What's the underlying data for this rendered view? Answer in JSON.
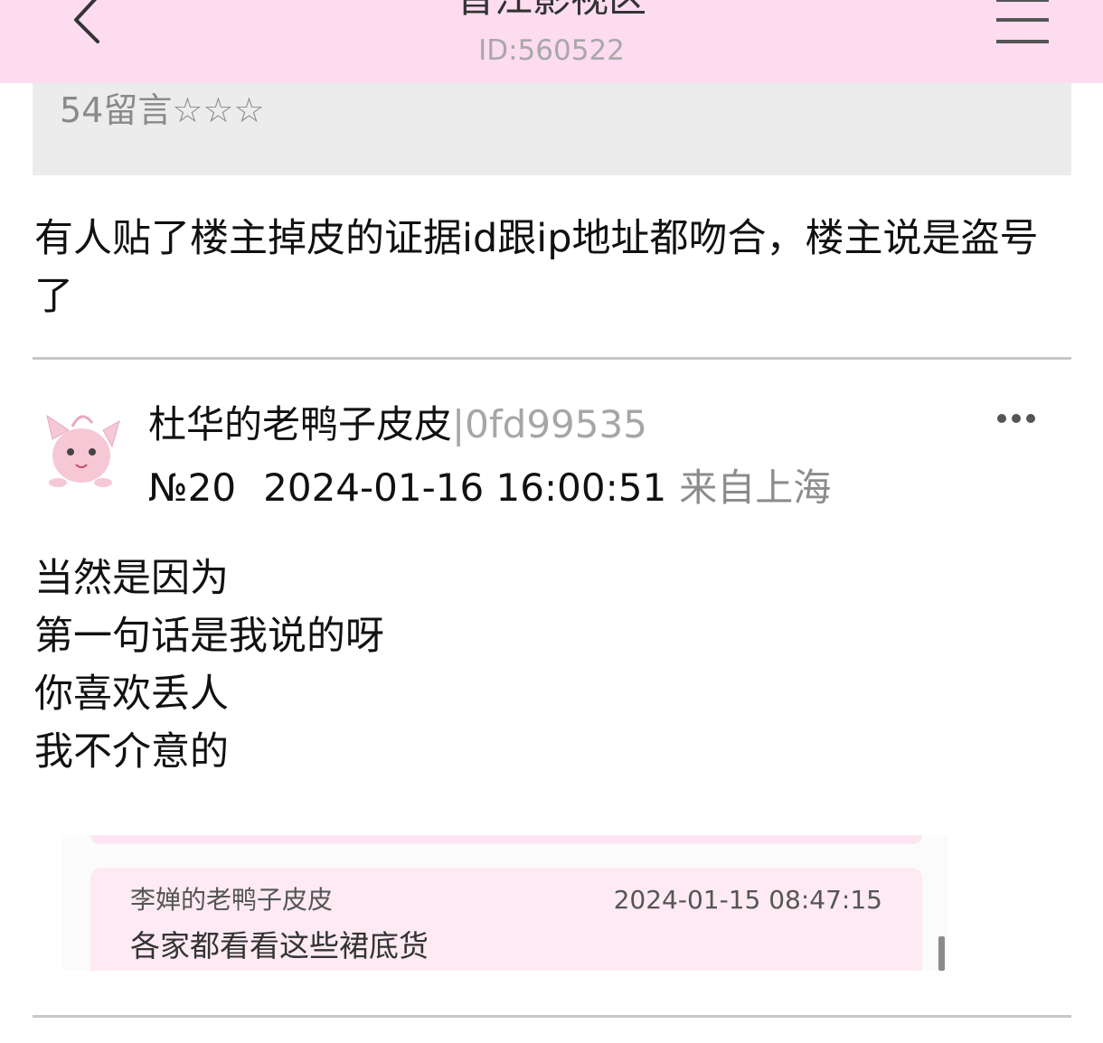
{
  "header": {
    "title": "晋江影视区",
    "subtitle": "ID:560522",
    "back_icon": "chevron-left-icon",
    "menu_icon": "hamburger-menu-icon",
    "background": "#fddcef"
  },
  "quoted_post": {
    "text": "54留言☆☆☆"
  },
  "post": {
    "body": "有人贴了楼主掉皮的证据id跟ip地址都吻合，楼主说是盗号了"
  },
  "reply": {
    "username": "杜华的老鸭子皮皮",
    "user_id": "|0fd99535",
    "floor": "№20",
    "datetime": "2024-01-16 16:00:51",
    "location": "来自上海",
    "avatar_icon": "avatar-icon",
    "more_icon": "more-options-icon",
    "lines": [
      "当然是因为",
      "第一句话是我说的呀",
      "你喜欢丢人",
      "我不介意的"
    ],
    "quote": {
      "username": "李婵的老鸭子皮皮",
      "datetime": "2024-01-15 08:47:15",
      "text": "各家都看看这些裙底货"
    }
  }
}
